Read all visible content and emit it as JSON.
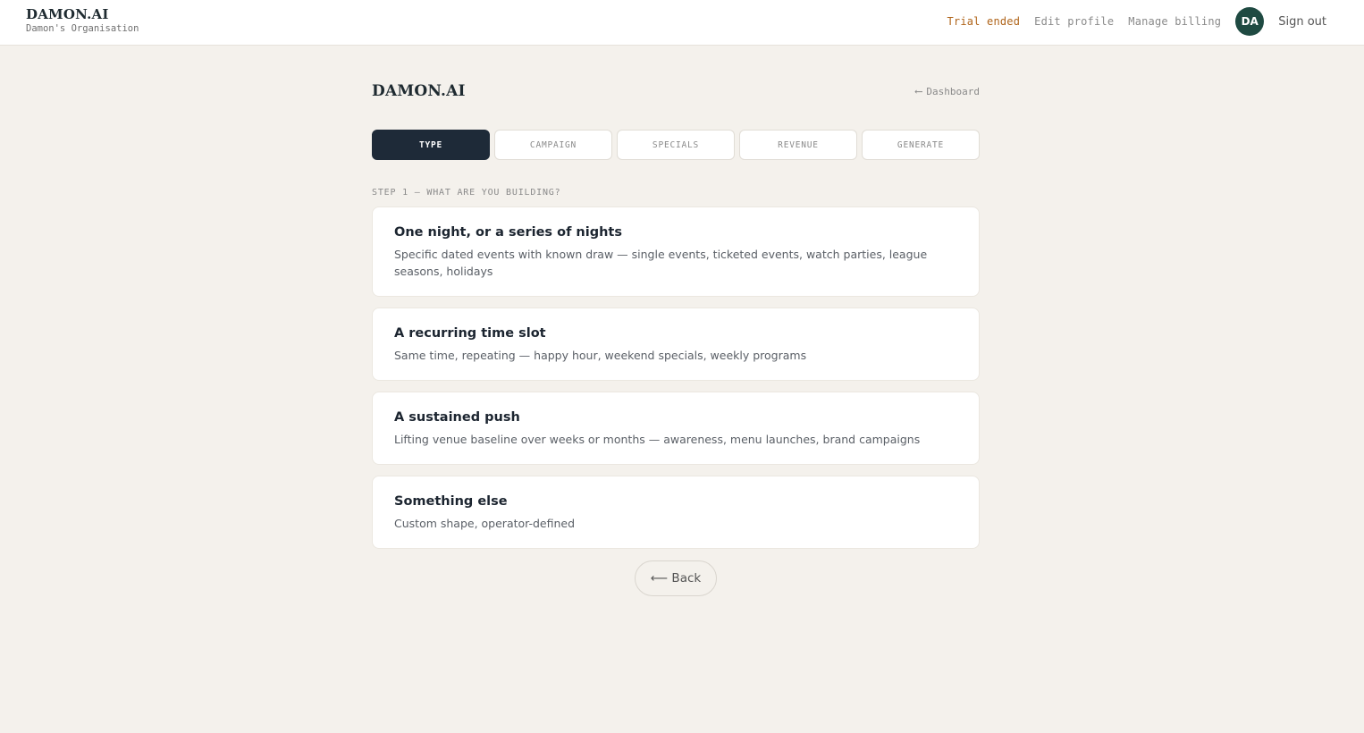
{
  "topbar": {
    "brand": "DAMON.AI",
    "org": "Damon's Organisation",
    "trial_status": "Trial ended",
    "edit_profile": "Edit profile",
    "manage_billing": "Manage billing",
    "avatar_initials": "DA",
    "sign_out": "Sign out"
  },
  "page": {
    "brand": "DAMON.AI",
    "dashboard_link": "Dashboard",
    "dashboard_arrow": "⟵"
  },
  "steps": [
    {
      "label": "TYPE"
    },
    {
      "label": "CAMPAIGN"
    },
    {
      "label": "SPECIALS"
    },
    {
      "label": "REVENUE"
    },
    {
      "label": "GENERATE"
    }
  ],
  "step_heading": "STEP 1 — WHAT ARE YOU BUILDING?",
  "options": [
    {
      "title": "One night, or a series of nights",
      "description": "Specific dated events with known draw — single events, ticketed events, watch parties, league seasons, holidays"
    },
    {
      "title": "A recurring time slot",
      "description": "Same time, repeating — happy hour, weekend specials, weekly programs"
    },
    {
      "title": "A sustained push",
      "description": "Lifting venue baseline over weeks or months — awareness, menu launches, brand campaigns"
    },
    {
      "title": "Something else",
      "description": "Custom shape, operator-defined"
    }
  ],
  "back_button": "⟵ Back",
  "colors": {
    "background": "#f4f1ec",
    "active_step": "#1e2a38",
    "avatar": "#1f4a42",
    "trial_text": "#b0651b"
  }
}
